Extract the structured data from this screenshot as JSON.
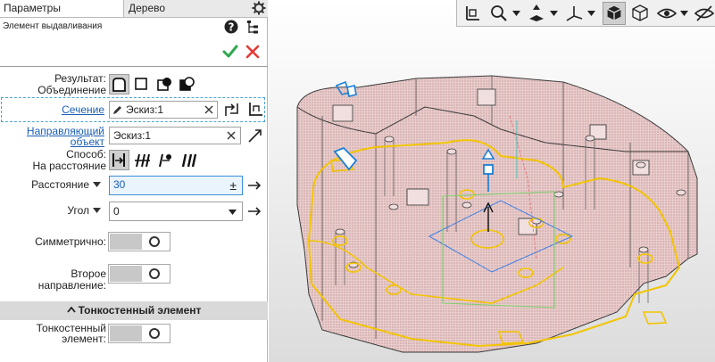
{
  "tabs": {
    "params": "Параметры",
    "tree": "Дерево"
  },
  "panel": {
    "subtitle": "Элемент выдавливания",
    "result_label": "Результат:",
    "result_value": "Объединение",
    "section_label": "Сечение",
    "section_value": "Эскиз:1",
    "direction_label_1": "Направляющий",
    "direction_label_2": "объект",
    "direction_value": "Эскиз:1",
    "method_label": "Способ:",
    "method_value": "На расстояние",
    "distance_label": "Расстояние",
    "distance_value": "30",
    "distance_pm": "±",
    "angle_label": "Угол",
    "angle_value": "0",
    "symmetric_label": "Симметрично:",
    "second_dir_label": "Второе направление:",
    "thin_section": "Тонкостенный элемент",
    "thin_label_1": "Тонкостенный",
    "thin_label_2": "элемент:"
  },
  "colors": {
    "accent_blue": "#1a5fb4",
    "ok_green": "#2fa84f",
    "cancel_red": "#e53935",
    "highlight_yellow": "#f2c400",
    "model_fill": "#e8c9c9"
  },
  "icons": {
    "help": "help-icon",
    "tree_view": "tree-view-icon",
    "ok": "checkmark-icon",
    "cancel": "close-icon",
    "settings": "gear-icon"
  }
}
